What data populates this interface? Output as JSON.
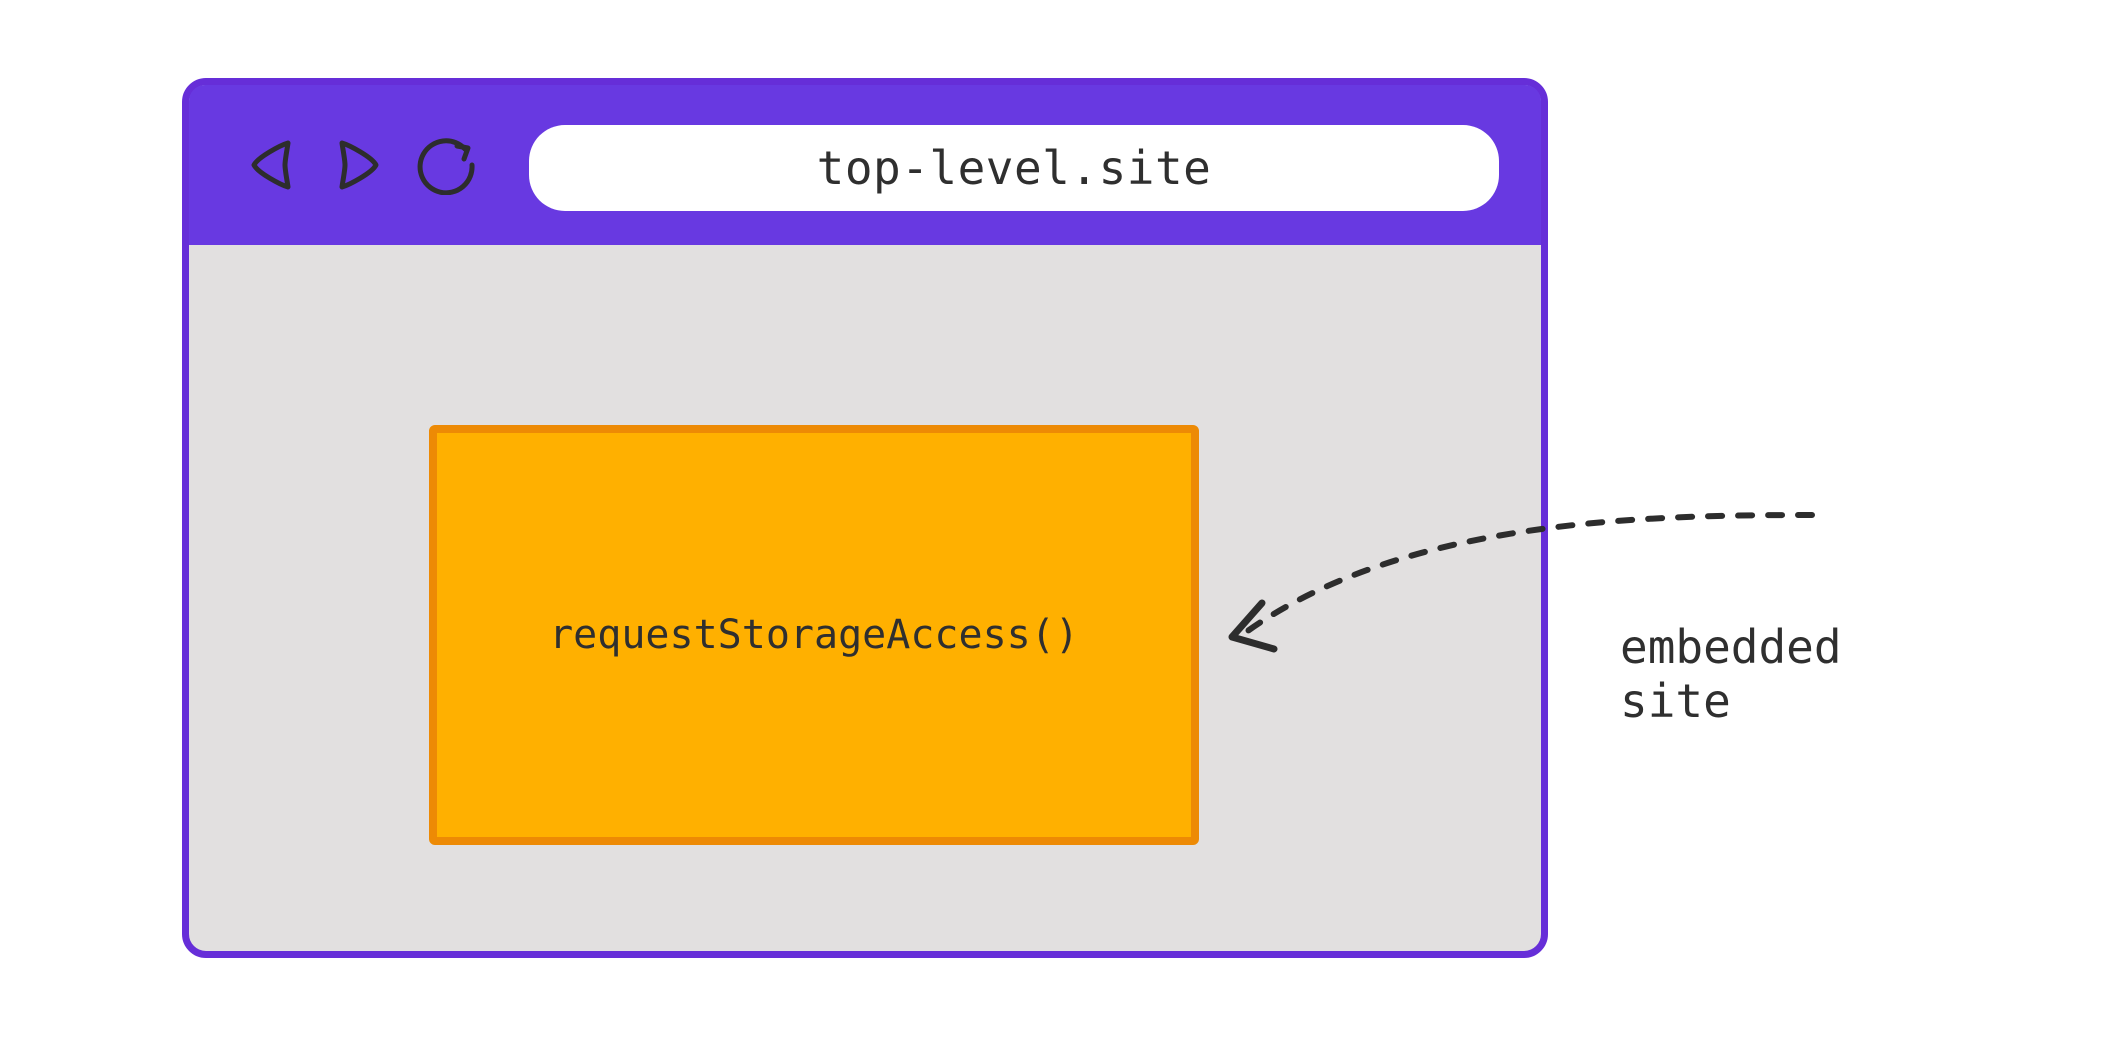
{
  "browser": {
    "url": "top-level.site",
    "nav": {
      "back_icon": "back",
      "forward_icon": "forward",
      "reload_icon": "reload"
    },
    "viewport": {
      "embedded_frame": {
        "code": "requestStorageAccess()"
      }
    }
  },
  "annotation": {
    "label": "embedded site"
  },
  "colors": {
    "browser_chrome": "#6839e1",
    "browser_border": "#662ed8",
    "viewport_bg": "#e2e0e0",
    "iframe_fill": "#ffb000",
    "iframe_border": "#ed8a05",
    "text": "#2f2f2f",
    "stroke": "#2d2d2d"
  }
}
